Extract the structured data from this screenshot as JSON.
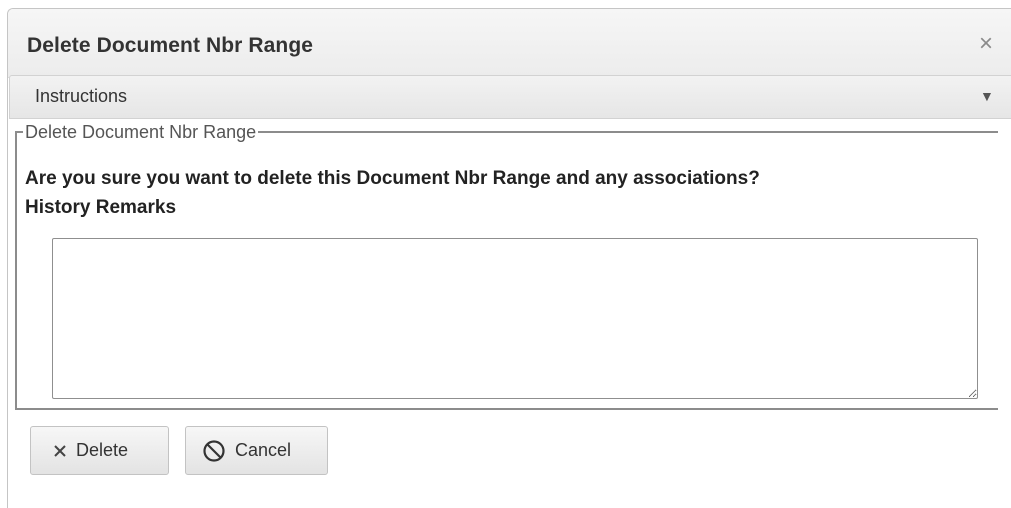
{
  "dialog": {
    "title": "Delete Document Nbr Range",
    "close_icon": "close-icon",
    "close_glyph": "×"
  },
  "instructions": {
    "label": "Instructions",
    "caret_icon": "caret-down-icon",
    "caret_glyph": "▼"
  },
  "fieldset": {
    "legend": "Delete Document Nbr Range",
    "confirm_text": "Are you sure you want to delete this Document Nbr Range and any associations?",
    "remarks_label": "History Remarks",
    "remarks_value": ""
  },
  "buttons": {
    "delete": {
      "label": "Delete",
      "icon": "x-icon"
    },
    "cancel": {
      "label": "Cancel",
      "icon": "prohibit-icon"
    }
  }
}
